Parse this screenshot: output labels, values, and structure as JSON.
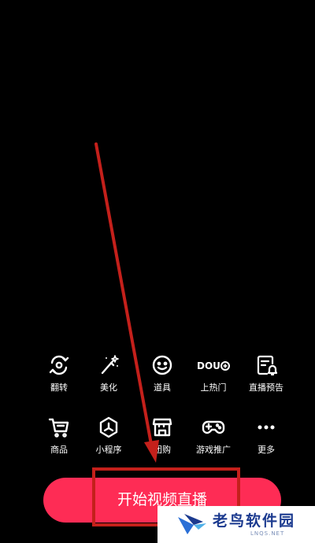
{
  "toolbar": {
    "row1": [
      {
        "label": "翻转",
        "icon": "flip-camera-icon"
      },
      {
        "label": "美化",
        "icon": "magic-wand-icon"
      },
      {
        "label": "道具",
        "icon": "smiley-face-icon"
      },
      {
        "label": "上热门",
        "icon": "dou-plus-icon"
      },
      {
        "label": "直播预告",
        "icon": "live-notice-icon"
      }
    ],
    "row2": [
      {
        "label": "商品",
        "icon": "shopping-cart-icon"
      },
      {
        "label": "小程序",
        "icon": "mini-program-icon"
      },
      {
        "label": "团购",
        "icon": "storefront-icon"
      },
      {
        "label": "游戏推广",
        "icon": "gamepad-icon"
      },
      {
        "label": "更多",
        "icon": "more-dots-icon"
      }
    ],
    "dou_text": "DOU"
  },
  "start_button": {
    "label": "开始视频直播"
  },
  "watermark": {
    "title": "老鸟软件园",
    "subtitle": "LNQS.NET"
  },
  "colors": {
    "background": "#000000",
    "primary_button": "#fe2c55",
    "annotation_red": "#c4201b",
    "watermark_blue": "#1b3a8f"
  }
}
